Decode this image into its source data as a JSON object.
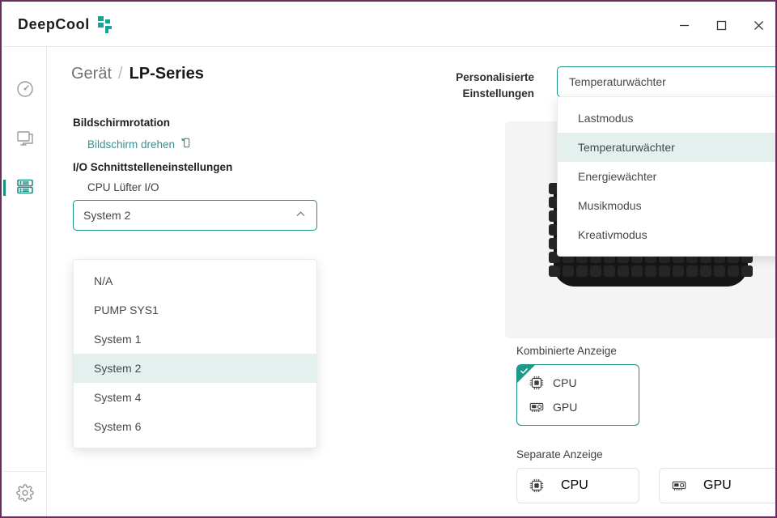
{
  "app": {
    "brand": "DeepCool",
    "logo_icon": "deepcool-mark-icon",
    "accent": "#1a8f84",
    "accent_bright": "#1a9b8a",
    "window_border": "#6b2d5c"
  },
  "window_controls": {
    "minimize": {
      "name": "minimize-button",
      "glyph": "–"
    },
    "maximize": {
      "name": "maximize-button",
      "glyph": "□"
    },
    "close": {
      "name": "close-button",
      "glyph": "✕"
    }
  },
  "sidebar": {
    "items": [
      {
        "icon": "dashboard-gauge-icon",
        "active": false
      },
      {
        "icon": "monitor-icon",
        "active": false
      },
      {
        "icon": "device-list-icon",
        "active": true
      }
    ],
    "bottom": {
      "icon": "gear-icon"
    }
  },
  "breadcrumb": {
    "root": "Gerät",
    "separator": "/",
    "current": "LP-Series"
  },
  "left_panel": {
    "rotation_title": "Bildschirmrotation",
    "rotate_link": "Bildschirm drehen",
    "rotate_icon": "rotate-screen-icon",
    "io_title": "I/O Schnittstelleneinstellungen",
    "fan_label": "CPU Lüfter I/O",
    "fan_select": {
      "value": "System 2",
      "chevron": "chevron-up-icon",
      "open": true,
      "options": [
        "N/A",
        "PUMP SYS1",
        "System 1",
        "System 2",
        "System 4",
        "System 6"
      ],
      "selected_index": 3
    }
  },
  "right_panel": {
    "personalized_label_line1": "Personalisierte",
    "personalized_label_line2": "Einstellungen",
    "mode_select": {
      "value": "Temperaturwächter",
      "chevron": "chevron-up-icon",
      "open": true,
      "options": [
        "Lastmodus",
        "Temperaturwächter",
        "Energiewächter",
        "Musikmodus",
        "Kreativmodus"
      ],
      "selected_index": 1
    },
    "preview": {
      "name": "led-matrix-preview",
      "rows": 7,
      "cols": 15,
      "lit": [
        [
          0,
          0,
          0,
          0,
          0,
          0,
          0,
          0,
          0,
          0,
          0,
          0,
          0,
          0,
          0
        ],
        [
          0,
          0,
          0,
          0,
          0,
          0,
          0,
          0,
          0,
          0,
          0,
          0,
          0,
          0,
          0
        ],
        [
          0,
          1,
          1,
          1,
          0,
          1,
          1,
          1,
          0,
          0,
          1,
          0,
          0,
          0,
          0
        ],
        [
          0,
          0,
          0,
          1,
          0,
          1,
          0,
          1,
          0,
          0,
          1,
          0,
          0,
          0,
          0
        ],
        [
          0,
          1,
          1,
          1,
          0,
          1,
          1,
          1,
          0,
          0,
          0,
          1,
          1,
          0,
          0
        ],
        [
          0,
          0,
          0,
          0,
          0,
          0,
          0,
          0,
          0,
          0,
          0,
          0,
          0,
          0,
          0
        ],
        [
          0,
          0,
          0,
          0,
          0,
          0,
          0,
          0,
          0,
          0,
          0,
          0,
          0,
          0,
          0
        ]
      ]
    },
    "combined": {
      "label": "Kombinierte Anzeige",
      "checked": true,
      "check_icon": "check-icon",
      "items": [
        {
          "label": "CPU",
          "icon": "cpu-chip-icon"
        },
        {
          "label": "GPU",
          "icon": "gpu-card-icon"
        }
      ]
    },
    "separate": {
      "label": "Separate Anzeige",
      "items": [
        {
          "label": "CPU",
          "icon": "cpu-chip-icon",
          "checked": false
        },
        {
          "label": "GPU",
          "icon": "gpu-card-icon",
          "checked": false
        }
      ]
    }
  }
}
